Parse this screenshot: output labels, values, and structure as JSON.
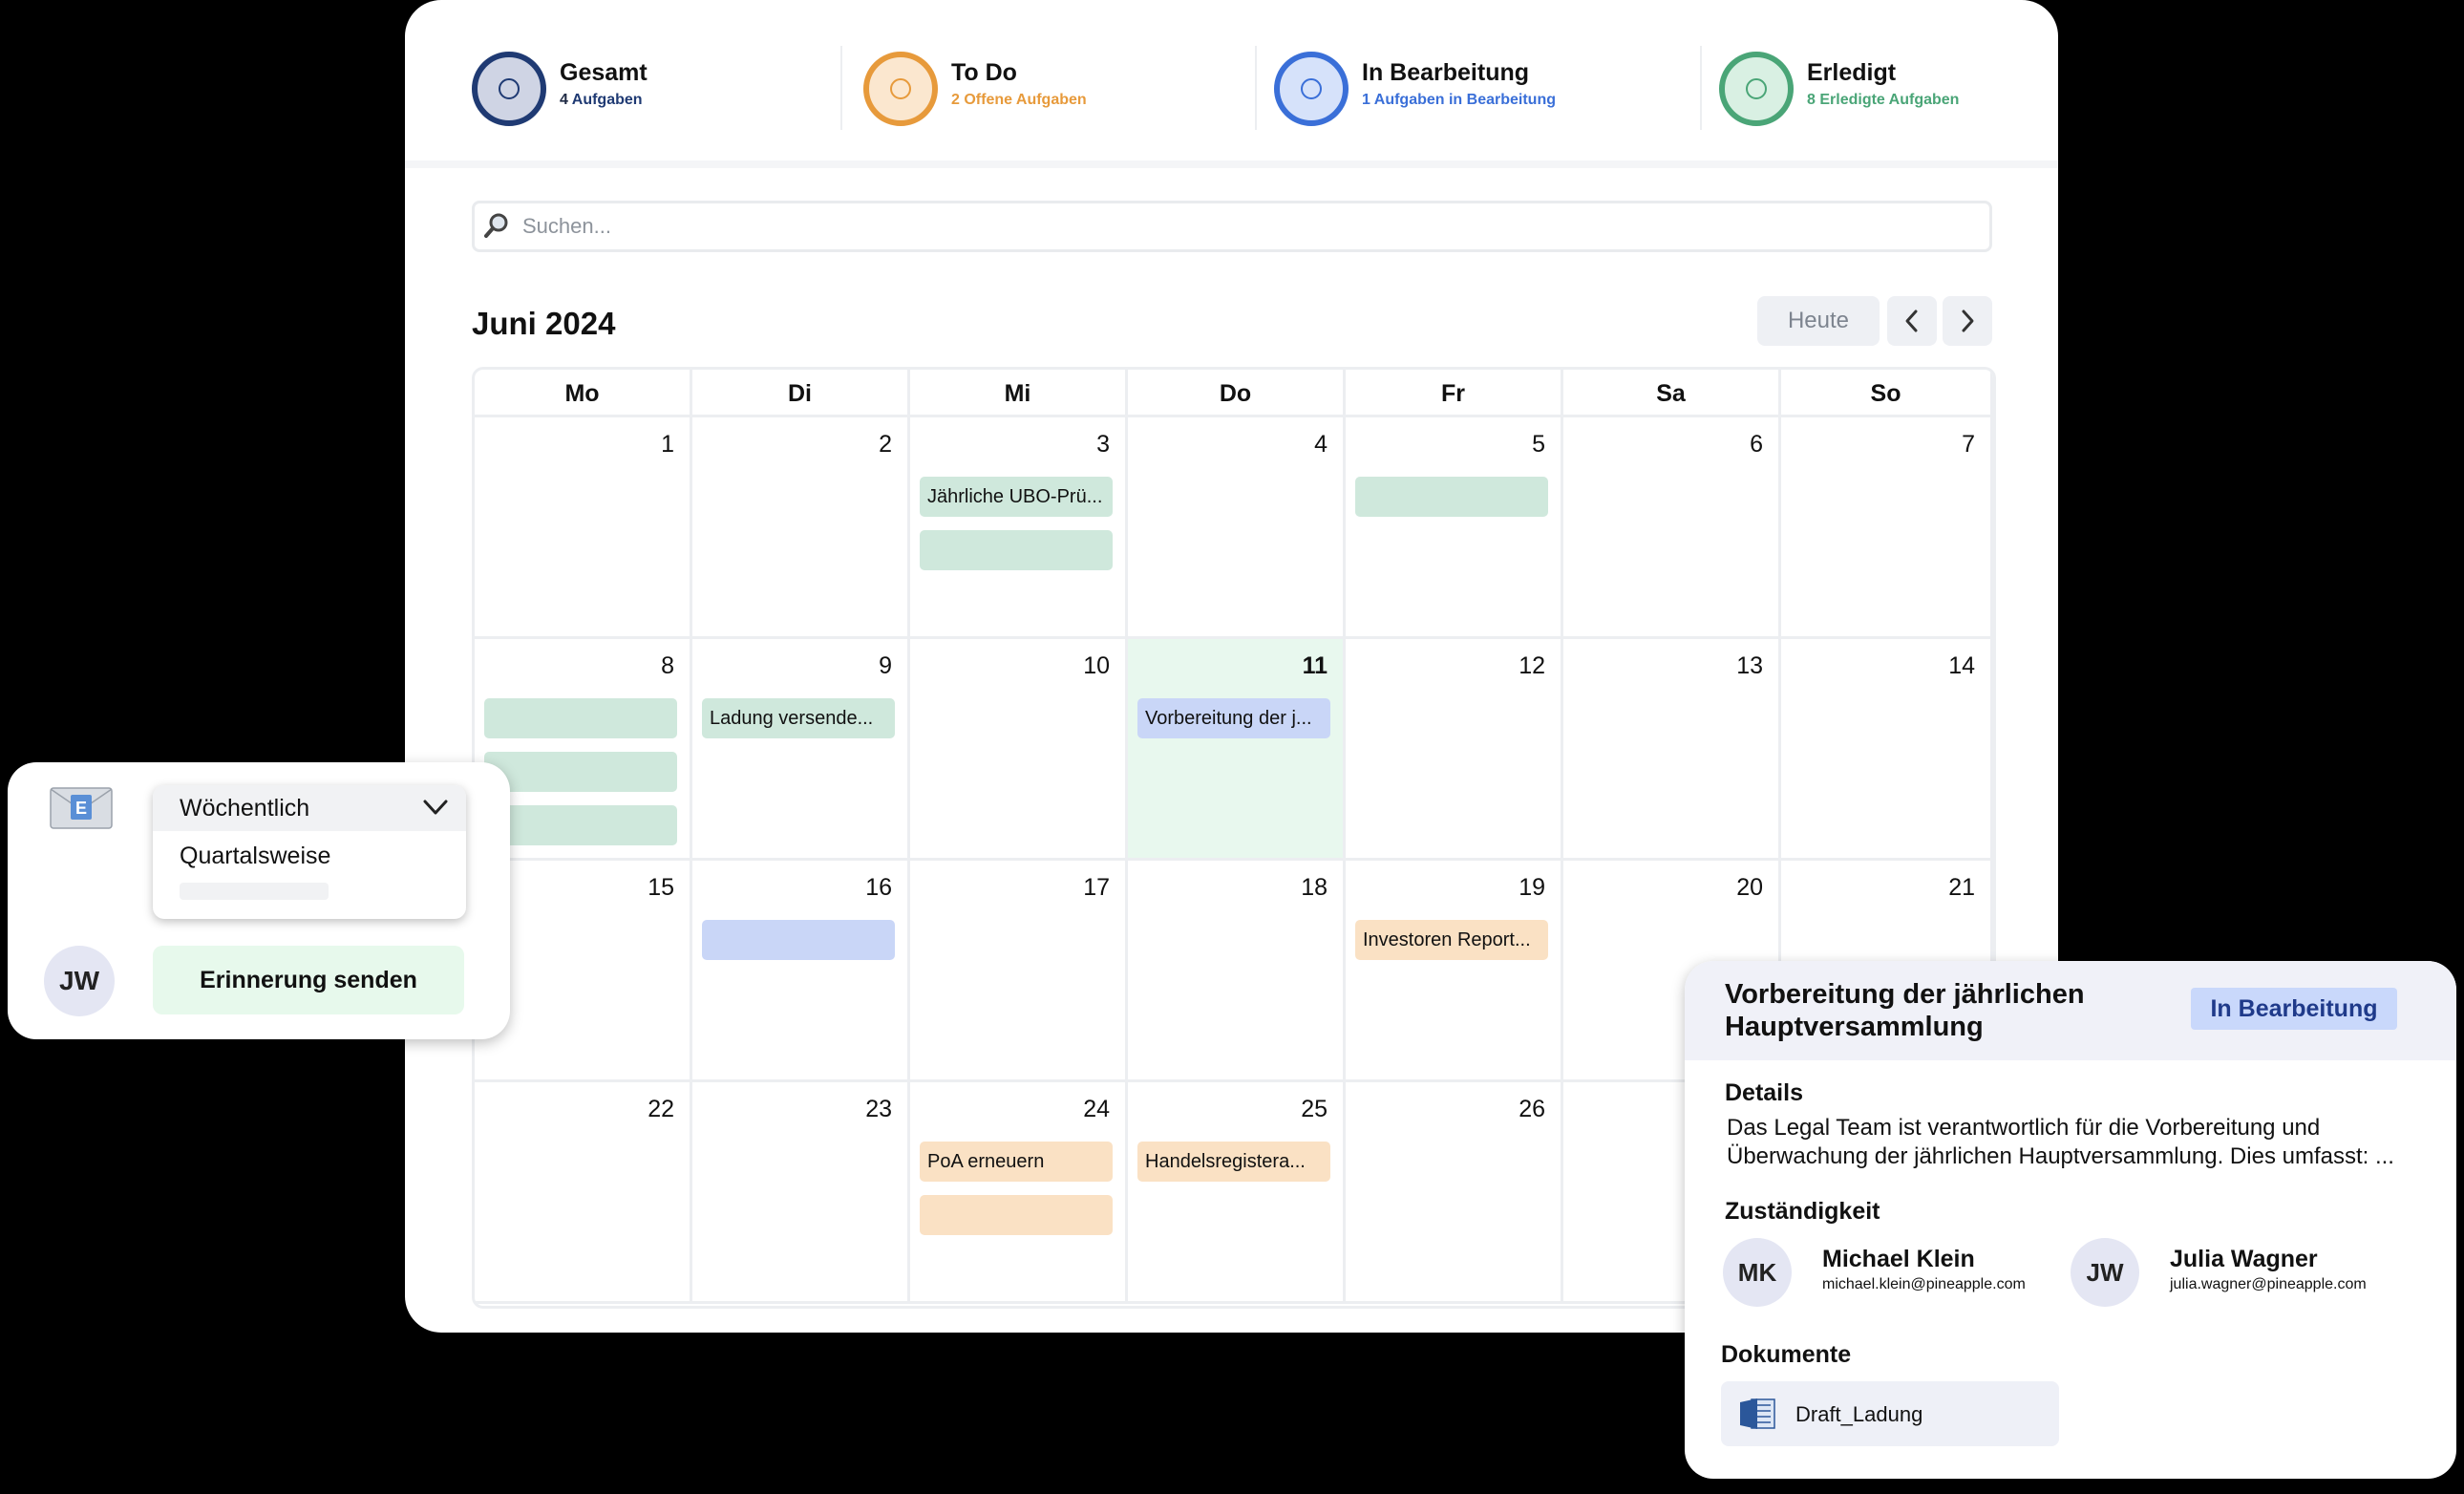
{
  "stats": [
    {
      "title": "Gesamt",
      "count": "4",
      "label": "Aufgaben",
      "color": "#1f3a73",
      "fill": "#cfd4e4",
      "label_color": "#1f3a73"
    },
    {
      "title": "To Do",
      "count": "2",
      "label": "Offene Aufgaben",
      "color": "#e79a3b",
      "fill": "#fbe7cf",
      "label_color": "#e79a3b"
    },
    {
      "title": "In Bearbeitung",
      "count": "1",
      "label": "Aufgaben in Bearbeitung",
      "color": "#3a6fd8",
      "fill": "#d6e2fa",
      "label_color": "#3a6fd8"
    },
    {
      "title": "Erledigt",
      "count": "8",
      "label": "Erledigte Aufgaben",
      "color": "#4aa577",
      "fill": "#d9f0e3",
      "label_color": "#4aa577"
    }
  ],
  "search": {
    "placeholder": "Suchen..."
  },
  "calendar": {
    "month_title": "Juni 2024",
    "today_label": "Heute",
    "weekdays": [
      "Mo",
      "Di",
      "Mi",
      "Do",
      "Fr",
      "Sa",
      "So"
    ],
    "today_day": 11,
    "weeks": [
      [
        {
          "day": "1",
          "events": []
        },
        {
          "day": "2",
          "events": []
        },
        {
          "day": "3",
          "events": [
            {
              "label": "Jährliche UBO-Prü...",
              "color": "green"
            },
            {
              "label": "",
              "color": "green"
            }
          ]
        },
        {
          "day": "4",
          "events": []
        },
        {
          "day": "5",
          "events": [
            {
              "label": "",
              "color": "green"
            }
          ]
        },
        {
          "day": "6",
          "events": []
        },
        {
          "day": "7",
          "events": []
        }
      ],
      [
        {
          "day": "8",
          "events": [
            {
              "label": "",
              "color": "green"
            },
            {
              "label": "",
              "color": "green"
            },
            {
              "label": "",
              "color": "green"
            }
          ]
        },
        {
          "day": "9",
          "events": [
            {
              "label": "Ladung versende...",
              "color": "green"
            }
          ]
        },
        {
          "day": "10",
          "events": []
        },
        {
          "day": "11",
          "events": [
            {
              "label": "Vorbereitung der j...",
              "color": "blue"
            }
          ]
        },
        {
          "day": "12",
          "events": []
        },
        {
          "day": "13",
          "events": []
        },
        {
          "day": "14",
          "events": []
        }
      ],
      [
        {
          "day": "15",
          "events": []
        },
        {
          "day": "16",
          "events": [
            {
              "label": "",
              "color": "blue"
            }
          ]
        },
        {
          "day": "17",
          "events": []
        },
        {
          "day": "18",
          "events": []
        },
        {
          "day": "19",
          "events": [
            {
              "label": "Investoren Report...",
              "color": "orange"
            }
          ]
        },
        {
          "day": "20",
          "events": []
        },
        {
          "day": "21",
          "events": []
        }
      ],
      [
        {
          "day": "22",
          "events": []
        },
        {
          "day": "23",
          "events": []
        },
        {
          "day": "24",
          "events": [
            {
              "label": "PoA erneuern",
              "color": "orange"
            },
            {
              "label": "",
              "color": "orange"
            }
          ]
        },
        {
          "day": "25",
          "events": [
            {
              "label": "Handelsregistera...",
              "color": "orange"
            }
          ]
        },
        {
          "day": "26",
          "events": []
        },
        {
          "day": "",
          "events": []
        },
        {
          "day": "",
          "events": []
        }
      ]
    ]
  },
  "reminder": {
    "selected": "Wöchentlich",
    "option": "Quartalsweise",
    "avatar": "JW",
    "send_label": "Erinnerung senden"
  },
  "detail": {
    "title": "Vorbereitung der jährlichen Hauptversammlung",
    "status": "In Bearbeitung",
    "details_label": "Details",
    "description": "Das Legal Team ist verantwortlich für die Vorbereitung und Überwachung der jährlichen Hauptversammlung. Dies umfasst: ...",
    "responsibility_label": "Zuständigkeit",
    "people": [
      {
        "initials": "MK",
        "name": "Michael Klein",
        "email": "michael.klein@pineapple.com"
      },
      {
        "initials": "JW",
        "name": "Julia Wagner",
        "email": "julia.wagner@pineapple.com"
      }
    ],
    "documents_label": "Dokumente",
    "document": "Draft_Ladung"
  }
}
